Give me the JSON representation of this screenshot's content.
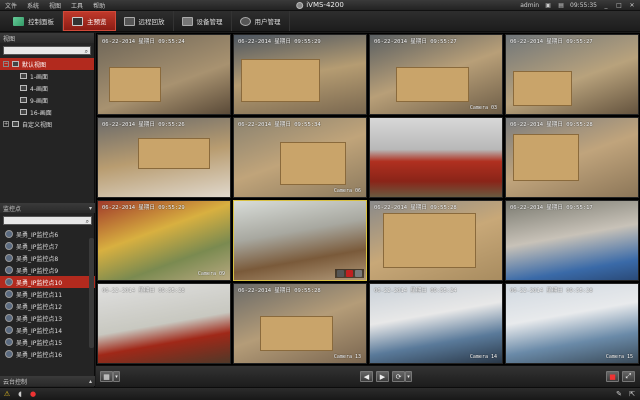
{
  "menubar": {
    "items": [
      "文件",
      "系统",
      "视图",
      "工具",
      "帮助"
    ],
    "app_title": "iVMS-4200",
    "user": "admin",
    "time": "09:55:35"
  },
  "tabs": [
    {
      "label": "控制面板",
      "icon": "control-panel-icon",
      "active": false
    },
    {
      "label": "主预览",
      "icon": "main-view-icon",
      "active": true
    },
    {
      "label": "远程回放",
      "icon": "remote-playback-icon",
      "active": false
    },
    {
      "label": "设备管理",
      "icon": "device-management-icon",
      "active": false
    },
    {
      "label": "用户管理",
      "icon": "user-management-icon",
      "active": false
    }
  ],
  "view_panel": {
    "header": "视图",
    "search_placeholder": "",
    "root": "默认视图",
    "layouts": [
      "1-画面",
      "4-画面",
      "9-画面",
      "16-画面"
    ],
    "custom": "自定义视图"
  },
  "camera_panel": {
    "header": "监控点",
    "cameras": [
      {
        "label": "吴勇_IP监控点6",
        "selected": false
      },
      {
        "label": "吴勇_IP监控点7",
        "selected": false
      },
      {
        "label": "吴勇_IP监控点8",
        "selected": false
      },
      {
        "label": "吴勇_IP监控点9",
        "selected": false
      },
      {
        "label": "吴勇_IP监控点10",
        "selected": true
      },
      {
        "label": "吴勇_IP监控点11",
        "selected": false
      },
      {
        "label": "吴勇_IP监控点12",
        "selected": false
      },
      {
        "label": "吴勇_IP监控点13",
        "selected": false
      },
      {
        "label": "吴勇_IP监控点14",
        "selected": false
      },
      {
        "label": "吴勇_IP监控点15",
        "selected": false
      },
      {
        "label": "吴勇_IP监控点16",
        "selected": false
      }
    ]
  },
  "ptz_panel": {
    "header": "云台控制"
  },
  "video_cells": [
    {
      "osd": "06-22-2014 星期日 09:55:24",
      "cam": "",
      "scene": "warehouse"
    },
    {
      "osd": "06-22-2014 星期日 09:55:29",
      "cam": "",
      "scene": "warehouse"
    },
    {
      "osd": "06-22-2014 星期日 09:55:27",
      "cam": "Camera 03",
      "scene": "warehouse"
    },
    {
      "osd": "06-22-2014 星期日 09:55:27",
      "cam": "",
      "scene": "warehouse"
    },
    {
      "osd": "06-22-2014 星期日 09:55:26",
      "cam": "",
      "scene": "warehouse"
    },
    {
      "osd": "06-22-2014 星期日 09:55:34",
      "cam": "Camera 06",
      "scene": "warehouse"
    },
    {
      "osd": "",
      "cam": "",
      "scene": "stairs"
    },
    {
      "osd": "06-22-2014 星期日 09:55:28",
      "cam": "",
      "scene": "warehouse"
    },
    {
      "osd": "06-22-2014 星期日 09:55:29",
      "cam": "Camera 09",
      "scene": "market"
    },
    {
      "osd": "",
      "cam": "",
      "scene": "office"
    },
    {
      "osd": "06-22-2014 星期日 09:55:28",
      "cam": "",
      "scene": "warehouse"
    },
    {
      "osd": "06-22-2014 星期日 09:55:17",
      "cam": "",
      "scene": "yard"
    },
    {
      "osd": "06-22-2014 星期日 09:55:28",
      "cam": "",
      "scene": "corridor"
    },
    {
      "osd": "06-22-2014 星期日 09:55:28",
      "cam": "Camera 13",
      "scene": "warehouse"
    },
    {
      "osd": "06-22-2014 星期日 09:55:24",
      "cam": "Camera 14",
      "scene": "shop"
    },
    {
      "osd": "06-22-2014 星期日 09:55:28",
      "cam": "Camera 15",
      "scene": "shop"
    }
  ],
  "colors": {
    "accent": "#b22a1e",
    "focus": "#d8c040"
  }
}
